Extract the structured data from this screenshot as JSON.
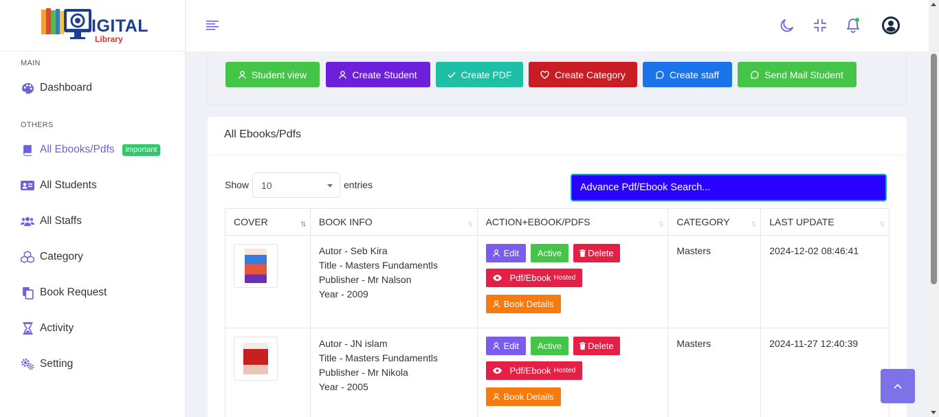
{
  "app": {
    "logo_text_main": "IGITAL",
    "logo_text_sub": "Library"
  },
  "sidebar": {
    "section_main": "MAIN",
    "section_others": "OTHERS",
    "items": [
      {
        "label": "Dashboard",
        "icon": "palette-icon"
      },
      {
        "label": "All Ebooks/Pdfs",
        "icon": "book-icon",
        "badge": "important"
      },
      {
        "label": "All Students",
        "icon": "id-card-icon"
      },
      {
        "label": "All Staffs",
        "icon": "users-icon"
      },
      {
        "label": "Category",
        "icon": "cubes-icon"
      },
      {
        "label": "Book Request",
        "icon": "copy-icon"
      },
      {
        "label": "Activity",
        "icon": "hourglass-icon"
      },
      {
        "label": "Setting",
        "icon": "gears-icon"
      }
    ]
  },
  "actions": {
    "student_view": "Student view",
    "create_student": "Create Student",
    "create_pdf": "Create PDF",
    "create_category": "Create Category",
    "create_staff": "Create staff",
    "send_mail": "Send Mail Student"
  },
  "card": {
    "title": "All Ebooks/Pdfs",
    "show": "Show",
    "entries": "entries",
    "page_size": "10",
    "search_placeholder": "Advance Pdf/Ebook Search..."
  },
  "table": {
    "headers": [
      "COVER",
      "BOOK INFO",
      "ACTION+EBOOK/PDFS",
      "CATEGORY",
      "LAST UPDATE"
    ],
    "labels": {
      "edit": "Edit",
      "active": "Active",
      "delete": "Delete",
      "pdf": "Pdf/Ebook",
      "hosted": "Hosted",
      "details": "Book Details"
    },
    "rows": [
      {
        "author": "Autor - Seb Kira",
        "title": "Title - Masters Fundamentls",
        "publisher": "Publisher - Mr Nalson",
        "year": "Year - 2009",
        "category": "Masters",
        "updated": "2024-12-02 08:46:41"
      },
      {
        "author": "Autor - JN islam",
        "title": "Title - Masters Fundamentls",
        "publisher": "Publisher - Mr Nikola",
        "year": "Year - 2005",
        "category": "Masters",
        "updated": "2024-11-27 12:40:39"
      }
    ]
  },
  "colors": {
    "accent": "#6b63d9",
    "green": "#44c548",
    "purple": "#6d1fd9",
    "teal": "#1fbfa6",
    "red": "#c81d25",
    "blue": "#1a73e8",
    "search_bg": "#2a00ff",
    "edit": "#7b5cf0",
    "delete": "#e52046",
    "orange": "#f77a0f"
  }
}
